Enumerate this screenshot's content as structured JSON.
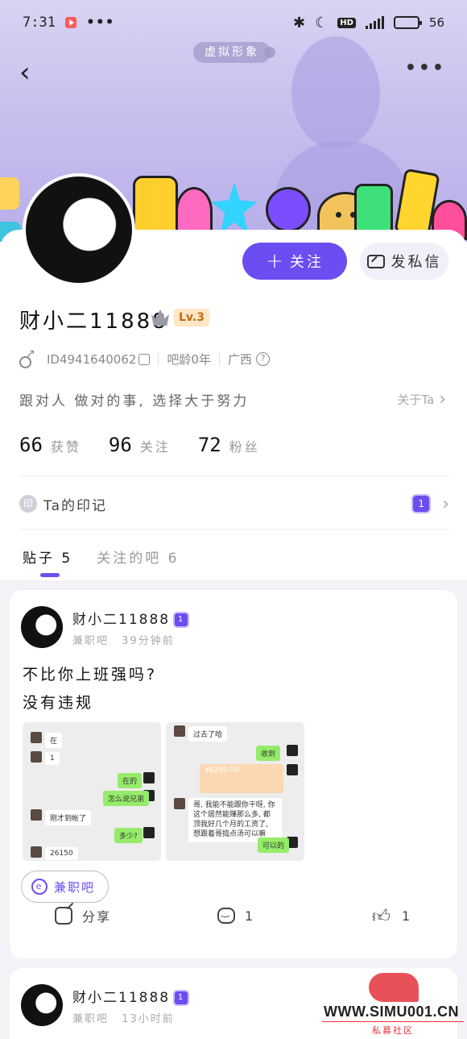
{
  "status_bar": {
    "time": "7:31",
    "dots": "•••",
    "battery_level": "56"
  },
  "header": {
    "virtual_tag": "虚拟形象",
    "back_icon": "chevron-left-icon",
    "more_icon": "more-horizontal-icon"
  },
  "profile": {
    "username": "财小二11888",
    "level": "Lv.3",
    "user_id": "ID4941640062",
    "account_age": "吧龄0年",
    "location": "广西",
    "bio": "跟对人 做对的事, 选择大于努力",
    "about_label": "关于Ta",
    "follow_label": "关注",
    "message_label": "发私信",
    "stats": [
      {
        "value": "66",
        "label": "获赞"
      },
      {
        "value": "96",
        "label": "关注"
      },
      {
        "value": "72",
        "label": "粉丝"
      }
    ],
    "mark_icon_text": "印",
    "mark_label": "Ta的印记",
    "medal_text": "1"
  },
  "tabs": [
    {
      "label": "贴子 5",
      "active": true
    },
    {
      "label": "关注的吧 6",
      "active": false
    }
  ],
  "posts": [
    {
      "author": "财小二11888",
      "badge": "1",
      "forum": "兼职吧",
      "time": "39分钟前",
      "lines": [
        "不比你上班强吗?",
        "没有违规"
      ],
      "chat_left": [
        "在",
        "1",
        "在的",
        "怎么说兄弟",
        "刚才到帐了",
        "多少?",
        "26150"
      ],
      "chat_right": [
        "过去了哈",
        "收到",
        "¥6250.00",
        "哥, 我能不能跟你干呀, 你这个居然能赚那么多, 都顶我好几个月的工资了, 想跟着哥捣点汤可以嘛",
        "可以的"
      ],
      "forum_chip": "兼职吧",
      "chip_icon_text": "e",
      "share_label": "分享",
      "comment_count": "1",
      "like_count": "1"
    },
    {
      "author": "财小二11888",
      "badge": "1",
      "forum": "兼职吧",
      "time": "13小时前"
    }
  ],
  "watermark": {
    "site": "WWW.SIMU001.CN",
    "sub": "私募社区"
  },
  "colors": {
    "accent": "#6b4df2",
    "banner": "#c9c0ee",
    "level_badge_bg": "#ffe6c4",
    "level_badge_text": "#c46a1a"
  }
}
